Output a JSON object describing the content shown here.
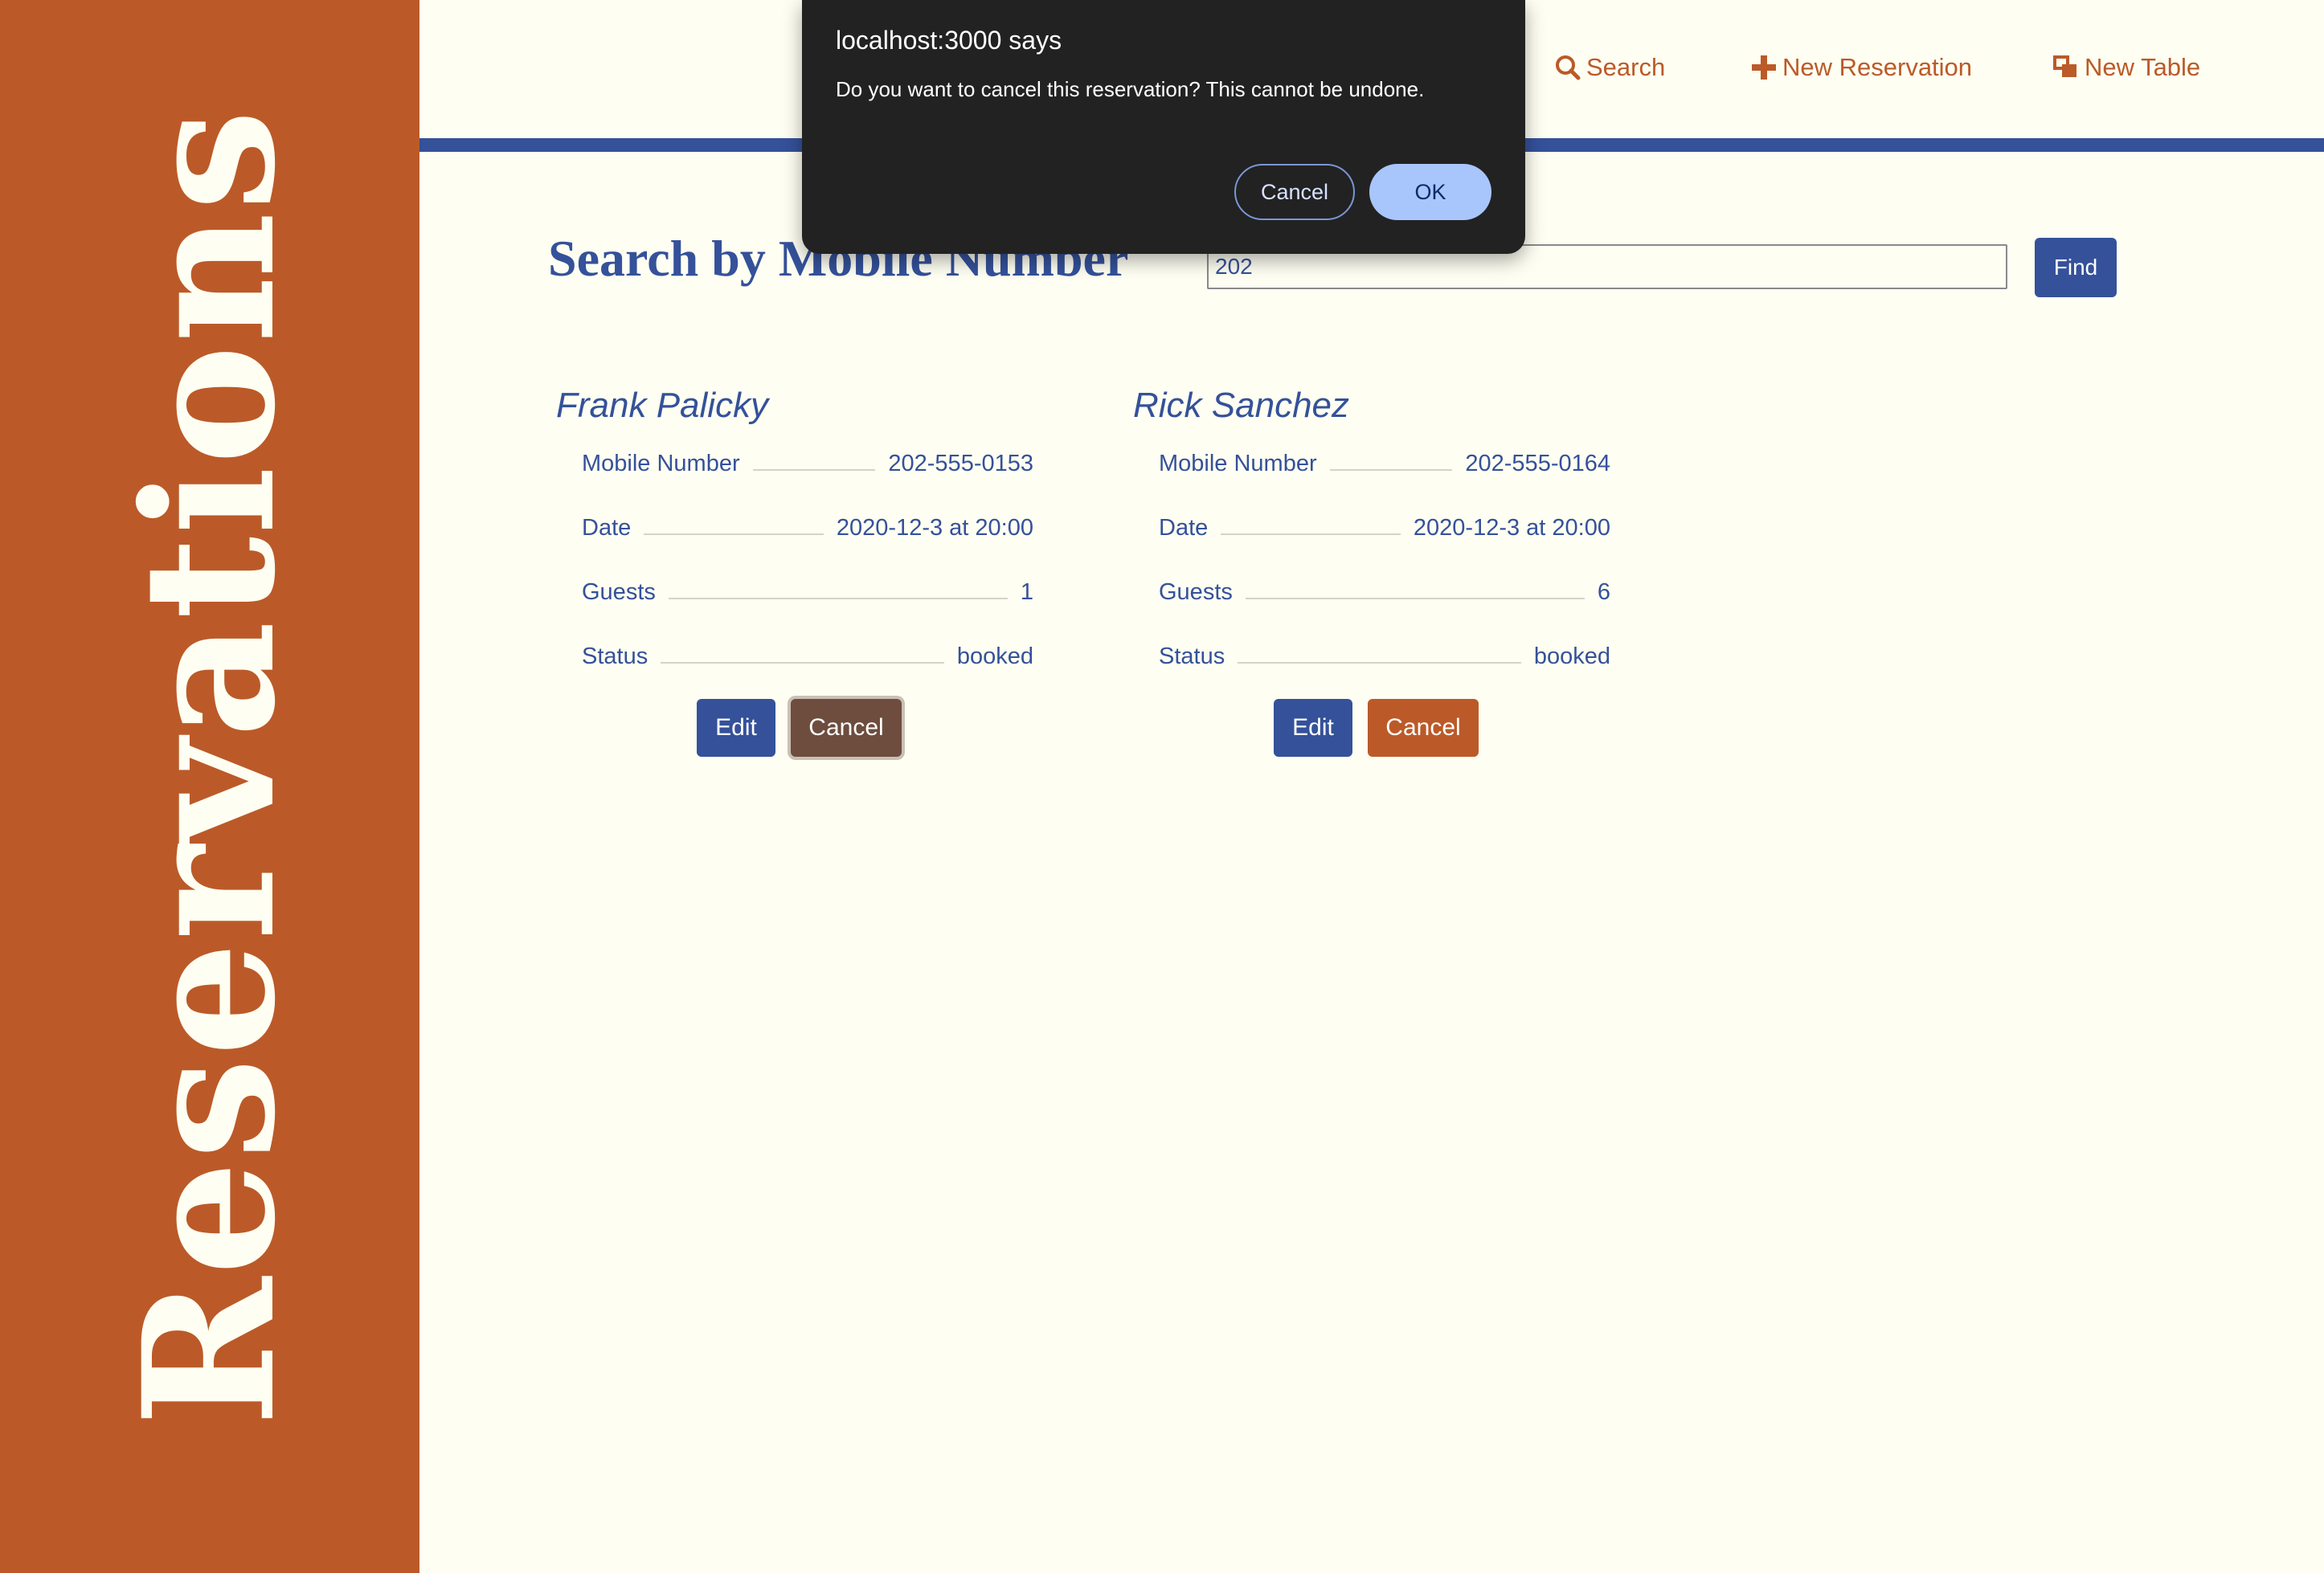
{
  "sidebar": {
    "title": "Reservations"
  },
  "nav": {
    "search_label": "Search",
    "new_reservation_label": "New Reservation",
    "new_table_label": "New Table"
  },
  "search": {
    "heading": "Search by Mobile Number",
    "input_value": "202",
    "find_label": "Find"
  },
  "reservations": [
    {
      "name": "Frank Palicky",
      "mobile_label": "Mobile Number",
      "mobile": "202-555-0153",
      "date_label": "Date",
      "date": "2020-12-3 at 20:00",
      "guests_label": "Guests",
      "guests": "1",
      "status_label": "Status",
      "status": "booked",
      "edit_label": "Edit",
      "cancel_label": "Cancel"
    },
    {
      "name": "Rick Sanchez",
      "mobile_label": "Mobile Number",
      "mobile": "202-555-0164",
      "date_label": "Date",
      "date": "2020-12-3 at 20:00",
      "guests_label": "Guests",
      "guests": "6",
      "status_label": "Status",
      "status": "booked",
      "edit_label": "Edit",
      "cancel_label": "Cancel"
    }
  ],
  "dialog": {
    "title": "localhost:3000 says",
    "message": "Do you want to cancel this reservation? This cannot be undone.",
    "cancel_label": "Cancel",
    "ok_label": "OK"
  },
  "icons": {
    "search": "search-icon",
    "new_reservation": "plus-icon",
    "new_table": "table-icon"
  },
  "colors": {
    "accent_orange": "#bb5a28",
    "accent_blue": "#34519a",
    "background": "#fefef2",
    "dialog_bg": "#222222",
    "dialog_ok": "#a8c6fb"
  }
}
